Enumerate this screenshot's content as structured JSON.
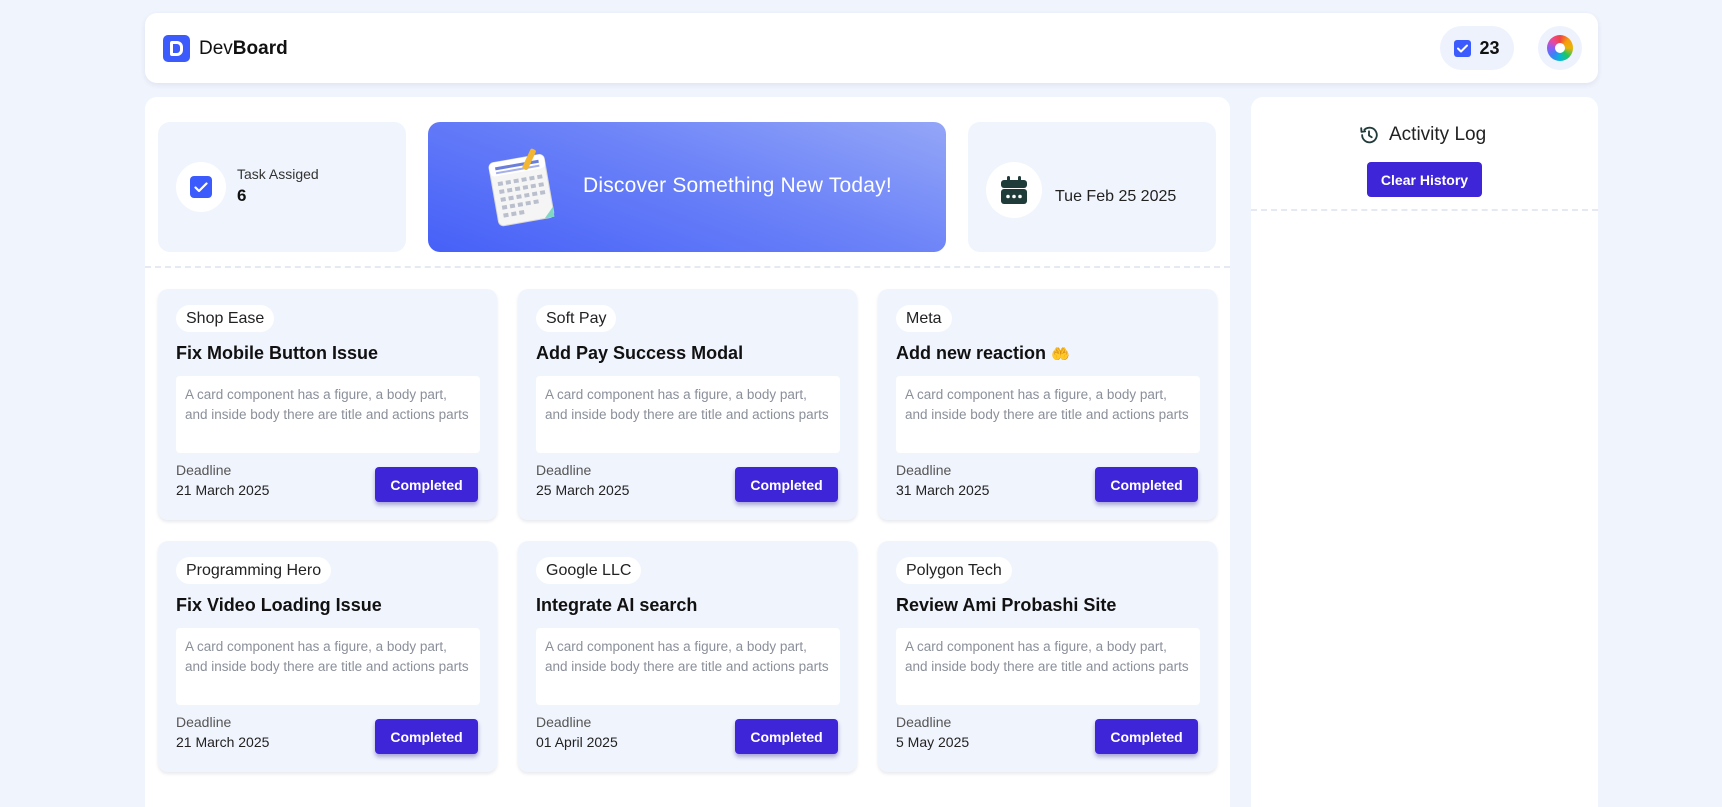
{
  "header": {
    "brand_light": "Dev",
    "brand_bold": "Board",
    "task_count": "23"
  },
  "stats": {
    "task_label": "Task Assiged",
    "task_value": "6",
    "banner_text": "Discover Something New Today!",
    "date": "Tue Feb 25 2025"
  },
  "cards": [
    {
      "company": "Shop Ease",
      "title": "Fix Mobile Button Issue",
      "description": "A card component has a figure, a body part, and inside body there are title and actions parts",
      "deadline_label": "Deadline",
      "deadline": "21 March 2025",
      "button": "Completed"
    },
    {
      "company": "Soft Pay",
      "title": "Add Pay Success Modal",
      "description": "A card component has a figure, a body part, and inside body there are title and actions parts",
      "deadline_label": "Deadline",
      "deadline": "25 March 2025",
      "button": "Completed"
    },
    {
      "company": "Meta",
      "title": "Add new reaction",
      "emoji": "🤲",
      "description": "A card component has a figure, a body part, and inside body there are title and actions parts",
      "deadline_label": "Deadline",
      "deadline": "31 March 2025",
      "button": "Completed"
    },
    {
      "company": "Programming Hero",
      "title": "Fix Video Loading Issue",
      "description": "A card component has a figure, a body part, and inside body there are title and actions parts",
      "deadline_label": "Deadline",
      "deadline": "21 March 2025",
      "button": "Completed"
    },
    {
      "company": "Google LLC",
      "title": "Integrate AI search",
      "description": "A card component has a figure, a body part, and inside body there are title and actions parts",
      "deadline_label": "Deadline",
      "deadline": "01 April 2025",
      "button": "Completed"
    },
    {
      "company": "Polygon Tech",
      "title": "Review Ami Probashi Site",
      "description": "A card component has a figure, a body part, and inside body there are title and actions parts",
      "deadline_label": "Deadline",
      "deadline": "5 May 2025",
      "button": "Completed"
    }
  ],
  "activity": {
    "title": "Activity Log",
    "clear_button": "Clear History"
  },
  "colors": {
    "accent": "#3b5bfd",
    "button": "#3f25d8",
    "background": "#f0f4fd"
  }
}
